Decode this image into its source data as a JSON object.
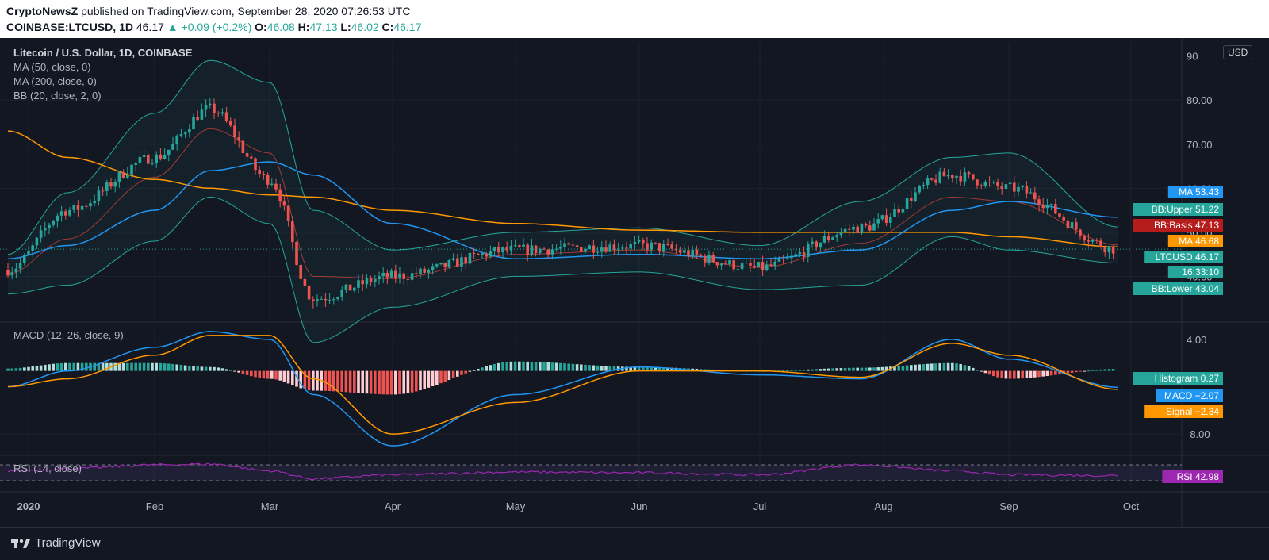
{
  "header": {
    "publisher": "CryptoNewsZ",
    "published_text": "published on TradingView.com, September 28, 2020 07:26:53 UTC",
    "symbol": "COINBASE:LTCUSD, 1D",
    "last": "46.17",
    "change": "▲ +0.09 (+0.2%)",
    "o_label": "O:",
    "o": "46.08",
    "h_label": "H:",
    "h": "47.13",
    "l_label": "L:",
    "l": "46.02",
    "c_label": "C:",
    "c": "46.17"
  },
  "legend": {
    "title": "Litecoin / U.S. Dollar, 1D, COINBASE",
    "ma50": "MA (50, close, 0)",
    "ma200": "MA (200, close, 0)",
    "bb": "BB (20, close, 2, 0)",
    "macd": "MACD (12, 26, close, 9)",
    "rsi": "RSI (14, close)"
  },
  "currency_button": "USD",
  "footer": {
    "brand": "TradingView"
  },
  "colors": {
    "background": "#131722",
    "up": "#26a69a",
    "down": "#ef5350",
    "ma50": "#2196f3",
    "ma200": "#ff9800",
    "bb": "#26a69a",
    "bb_basis": "#e0443c",
    "macd": "#2196f3",
    "signal": "#ff9800",
    "rsi": "#9c27b0"
  },
  "chart_data": [
    {
      "type": "candlestick",
      "title": "Litecoin / U.S. Dollar, 1D, COINBASE",
      "x_ticks": [
        "2020",
        "Feb",
        "Mar",
        "Apr",
        "May",
        "Jun",
        "Jul",
        "Aug",
        "Sep",
        "Oct"
      ],
      "y_ticks": [
        "90",
        "80.00",
        "70.00",
        "60.00",
        "50.00",
        "40.00"
      ],
      "ylim": [
        30,
        93
      ],
      "series": [
        {
          "name": "LTCUSD close (approx. monthly)",
          "x": [
            "2020-01-01",
            "2020-01-15",
            "2020-02-01",
            "2020-02-15",
            "2020-03-01",
            "2020-03-13",
            "2020-04-01",
            "2020-05-01",
            "2020-06-01",
            "2020-07-01",
            "2020-07-25",
            "2020-08-15",
            "2020-09-01",
            "2020-09-28"
          ],
          "values": [
            41.5,
            55,
            67,
            78,
            62,
            35,
            40,
            46,
            47,
            42,
            51,
            63,
            60,
            46.17
          ]
        },
        {
          "name": "MA",
          "values": [
            44,
            47,
            55,
            64,
            66,
            63,
            52,
            44,
            45,
            44,
            46,
            55,
            57,
            53.43
          ]
        },
        {
          "name": "MA",
          "values": [
            73,
            67,
            62,
            60,
            58.5,
            58,
            55,
            52,
            50.5,
            50,
            50,
            50,
            49,
            46.68
          ]
        },
        {
          "name": "BB:Upper",
          "values": [
            45,
            59,
            77,
            89,
            84,
            55,
            46,
            50,
            51,
            47,
            57,
            67,
            68,
            51.22
          ]
        },
        {
          "name": "BB:Lower",
          "values": [
            36,
            38,
            48,
            58,
            52,
            25,
            33,
            40,
            41,
            37,
            38,
            49,
            46,
            43.04
          ]
        }
      ],
      "labels": [
        {
          "name": "MA",
          "value": "53.43",
          "color": "#2196f3"
        },
        {
          "name": "BB:Upper",
          "value": "51.22",
          "color": "#26a69a"
        },
        {
          "name": "BB:Basis",
          "value": "47.13",
          "color": "#b71c1c"
        },
        {
          "name": "MA",
          "value": "46.68",
          "color": "#ff9800"
        },
        {
          "name": "LTCUSD",
          "value": "46.17",
          "color": "#26a69a"
        },
        {
          "name": "",
          "value": "16:33:10",
          "color": "#26a69a"
        },
        {
          "name": "BB:Lower",
          "value": "43.04",
          "color": "#26a69a"
        }
      ]
    },
    {
      "type": "line",
      "title": "MACD (12, 26, close, 9)",
      "y_ticks": [
        "4.00",
        "-8.00"
      ],
      "ylim": [
        -10.5,
        6.0
      ],
      "series": [
        {
          "name": "MACD",
          "values": [
            -2,
            0,
            3,
            5,
            4,
            -3,
            -9.5,
            -3,
            0.5,
            -0.5,
            -1,
            4,
            1.5,
            -2.07
          ]
        },
        {
          "name": "Signal",
          "values": [
            -2,
            -1,
            2,
            4.5,
            4.5,
            -1,
            -8,
            -4,
            0,
            0,
            -0.8,
            3.5,
            2,
            -2.34
          ]
        },
        {
          "name": "Histogram",
          "values": [
            0.3,
            1,
            1,
            0.5,
            -1,
            -2.5,
            -3,
            1.2,
            0.5,
            0,
            0.4,
            1,
            -1,
            0.27
          ]
        }
      ],
      "labels": [
        {
          "name": "Histogram",
          "value": "0.27",
          "color": "#26a69a"
        },
        {
          "name": "MACD",
          "value": "−2.07",
          "color": "#2196f3"
        },
        {
          "name": "Signal",
          "value": "−2.34",
          "color": "#ff9800"
        }
      ]
    },
    {
      "type": "line",
      "title": "RSI (14, close)",
      "series": [
        {
          "name": "RSI",
          "values": [
            55,
            60,
            70,
            72,
            55,
            35,
            45,
            52,
            50,
            45,
            70,
            55,
            45,
            42.98
          ]
        }
      ],
      "labels": [
        {
          "name": "RSI",
          "value": "42.98",
          "color": "#9c27b0"
        }
      ]
    }
  ]
}
